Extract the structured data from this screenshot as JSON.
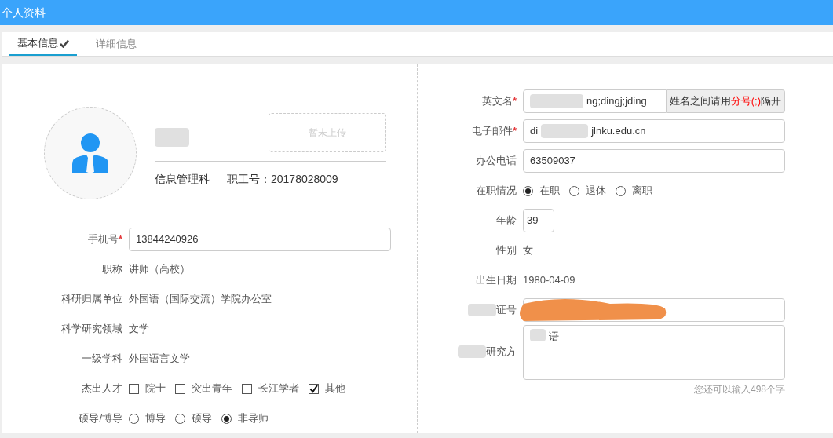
{
  "header": {
    "title": "个人资料"
  },
  "tabs": [
    {
      "label": "基本信息",
      "selected": true,
      "done": true
    },
    {
      "label": "详细信息",
      "selected": false,
      "done": false
    }
  ],
  "profile": {
    "upload_placeholder": "暂未上传",
    "department": "信息管理科",
    "staff_no": "职工号：20178028009"
  },
  "left_fields": [
    {
      "kind": "input",
      "label": "手机号",
      "required_mark": "*",
      "value": "13844240926"
    },
    {
      "kind": "text",
      "label": "职称",
      "value": "讲师（高校）"
    },
    {
      "kind": "text",
      "label": "科研归属单位",
      "value": "外国语（国际交流）学院办公室"
    },
    {
      "kind": "text",
      "label": "科学研究领域",
      "value": "文学"
    },
    {
      "kind": "text",
      "label": "一级学科",
      "value": "外国语言文学"
    },
    {
      "kind": "checkboxes",
      "label": "杰出人才",
      "options": [
        {
          "label": "院士",
          "checked": false
        },
        {
          "label": "突出青年",
          "checked": false
        },
        {
          "label": "长江学者",
          "checked": false
        },
        {
          "label": "其他",
          "checked": true
        }
      ]
    },
    {
      "kind": "radios",
      "label": "硕导/博导",
      "options": [
        {
          "label": "博导",
          "selected": false
        },
        {
          "label": "硕导",
          "selected": false
        },
        {
          "label": "非导师",
          "selected": true
        }
      ]
    }
  ],
  "right_fields": [
    {
      "kind": "input",
      "label": "英文名",
      "required_mark": "*",
      "value": "ng;dingj;jding",
      "addon": "姓名之间请用**分号(;)**隔开",
      "redacted": true
    },
    {
      "kind": "input",
      "label": "电子邮件",
      "required_mark": "*",
      "value": "di",
      "value_end": "jlnku.edu.cn",
      "redacted": true
    },
    {
      "kind": "input",
      "label": "办公电话",
      "value": "63509037"
    },
    {
      "kind": "radios",
      "label": "在职情况",
      "options": [
        {
          "label": "在职",
          "selected": true
        },
        {
          "label": "退休",
          "selected": false
        },
        {
          "label": "离职",
          "selected": false
        }
      ]
    },
    {
      "kind": "small_input",
      "label": "年龄",
      "value": "39"
    },
    {
      "kind": "text",
      "label": "性别",
      "value": "女"
    },
    {
      "kind": "text",
      "label": "出生日期",
      "value": "1980-04-09"
    },
    {
      "kind": "input",
      "label": "证号",
      "redacted": true
    },
    {
      "kind": "textarea",
      "label": "研究方",
      "value": "语",
      "hint": "您还可以输入498个字",
      "redacted": true
    }
  ]
}
